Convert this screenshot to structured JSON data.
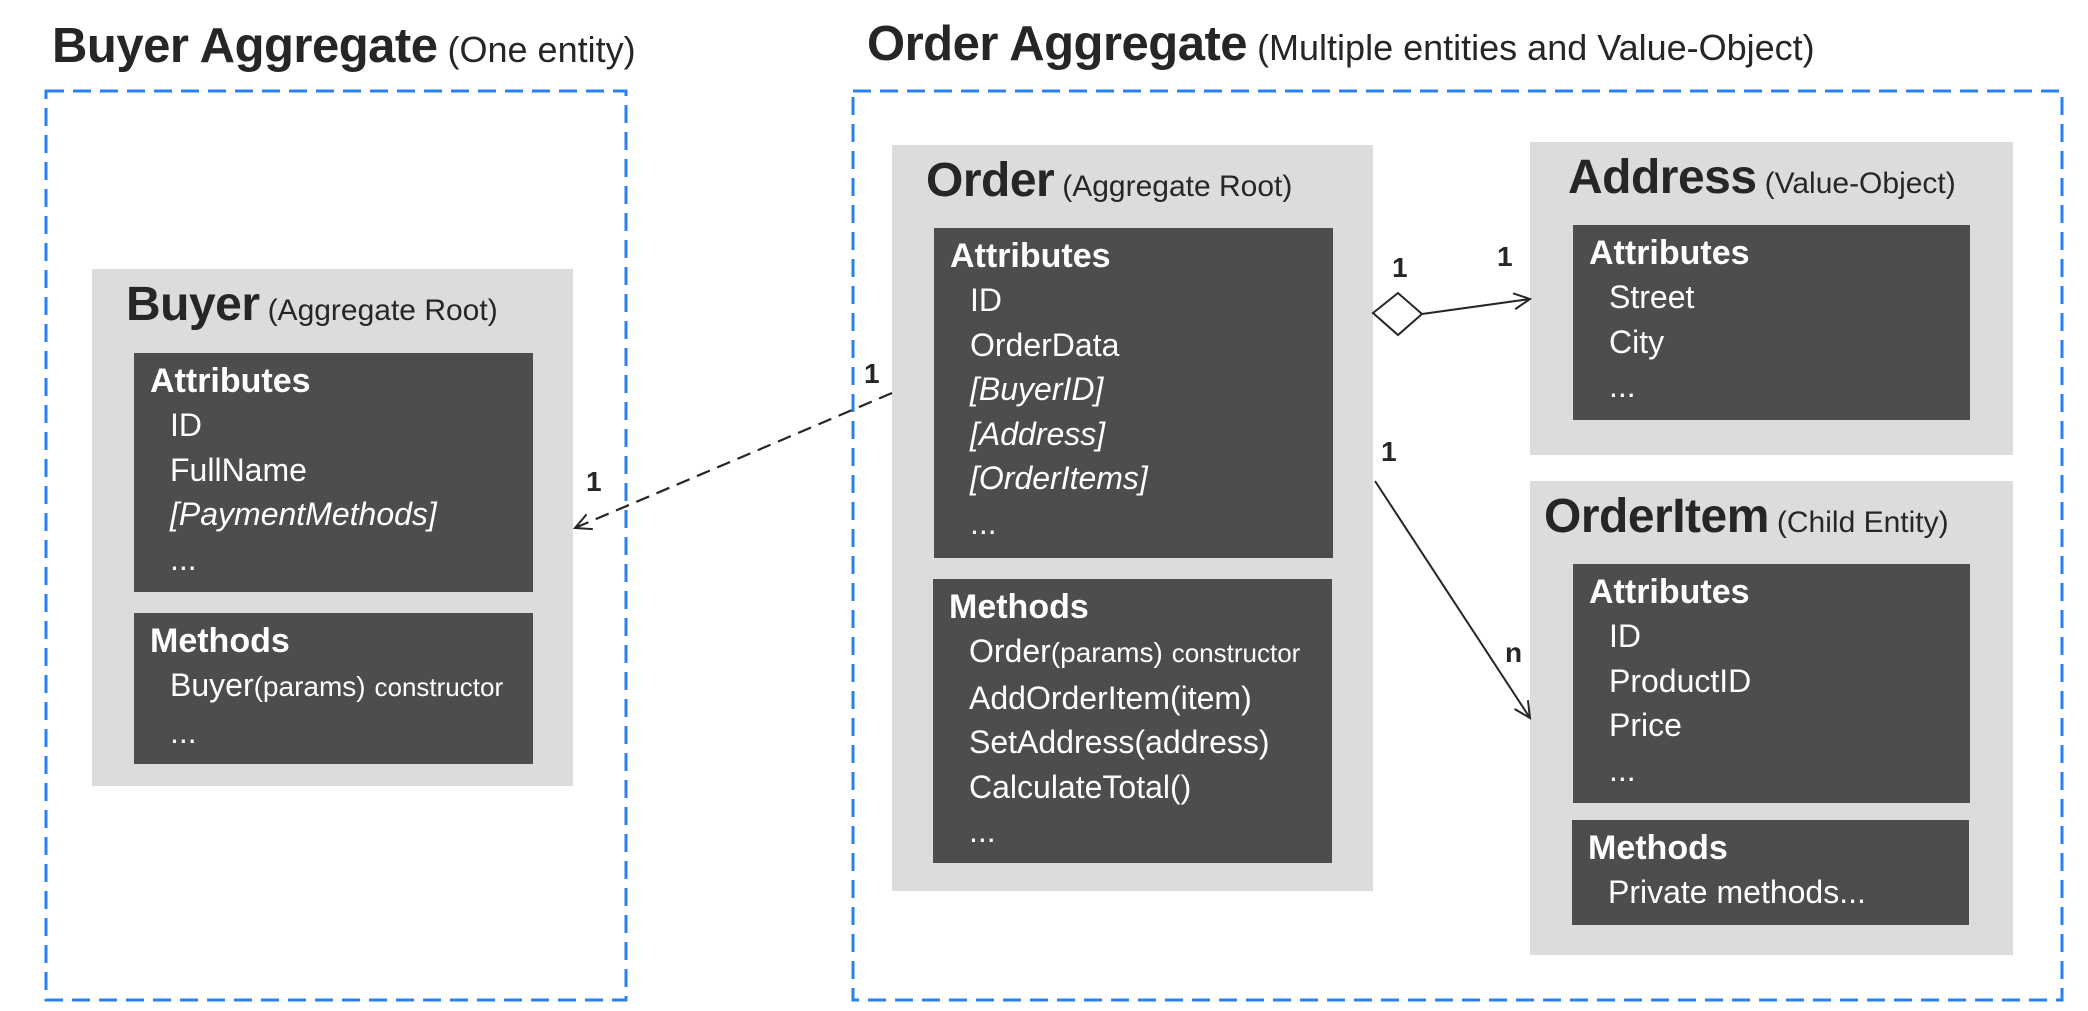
{
  "colors": {
    "aggregate_border": "#2a7ff2",
    "entity_bg": "#dcdcdc",
    "panel_bg": "#4d4d4d",
    "text_dark": "#262626",
    "connector": "#262626"
  },
  "buyer_aggregate": {
    "title": "Buyer Aggregate",
    "subtitle": "(One entity)",
    "buyer": {
      "name": "Buyer",
      "role": "(Aggregate Root)",
      "attributes": {
        "heading": "Attributes",
        "items": [
          "ID",
          "FullName",
          "[PaymentMethods]",
          "..."
        ]
      },
      "methods": {
        "heading": "Methods",
        "items": [
          {
            "name": "Buyer",
            "params": "(params)",
            "note": "constructor"
          },
          {
            "name": "..."
          }
        ]
      }
    }
  },
  "order_aggregate": {
    "title": "Order Aggregate",
    "subtitle": "(Multiple entities and Value-Object)",
    "order": {
      "name": "Order",
      "role": "(Aggregate Root)",
      "attributes": {
        "heading": "Attributes",
        "items": [
          "ID",
          "OrderData",
          "[BuyerID]",
          "[Address]",
          "[OrderItems]",
          "..."
        ]
      },
      "methods": {
        "heading": "Methods",
        "items": [
          {
            "name": "Order",
            "params": "(params)",
            "note": "constructor"
          },
          {
            "name": "AddOrderItem(item)"
          },
          {
            "name": "SetAddress(address)"
          },
          {
            "name": "CalculateTotal()"
          },
          {
            "name": "..."
          }
        ]
      }
    },
    "address": {
      "name": "Address",
      "role": "(Value-Object)",
      "attributes": {
        "heading": "Attributes",
        "items": [
          "Street",
          "City",
          "..."
        ]
      }
    },
    "order_item": {
      "name": "OrderItem",
      "role": "(Child Entity)",
      "attributes": {
        "heading": "Attributes",
        "items": [
          "ID",
          "ProductID",
          "Price",
          "..."
        ]
      },
      "methods": {
        "heading": "Methods",
        "items": [
          "Private methods..."
        ]
      }
    }
  },
  "relationships": [
    {
      "from": "Order",
      "to": "Buyer",
      "style": "dashed",
      "from_multiplicity": "1",
      "to_multiplicity": "1"
    },
    {
      "from": "Order",
      "to": "Address",
      "style": "aggregation",
      "from_multiplicity": "1",
      "to_multiplicity": "1"
    },
    {
      "from": "Order",
      "to": "OrderItem",
      "style": "solid",
      "from_multiplicity": "1",
      "to_multiplicity": "n"
    }
  ]
}
